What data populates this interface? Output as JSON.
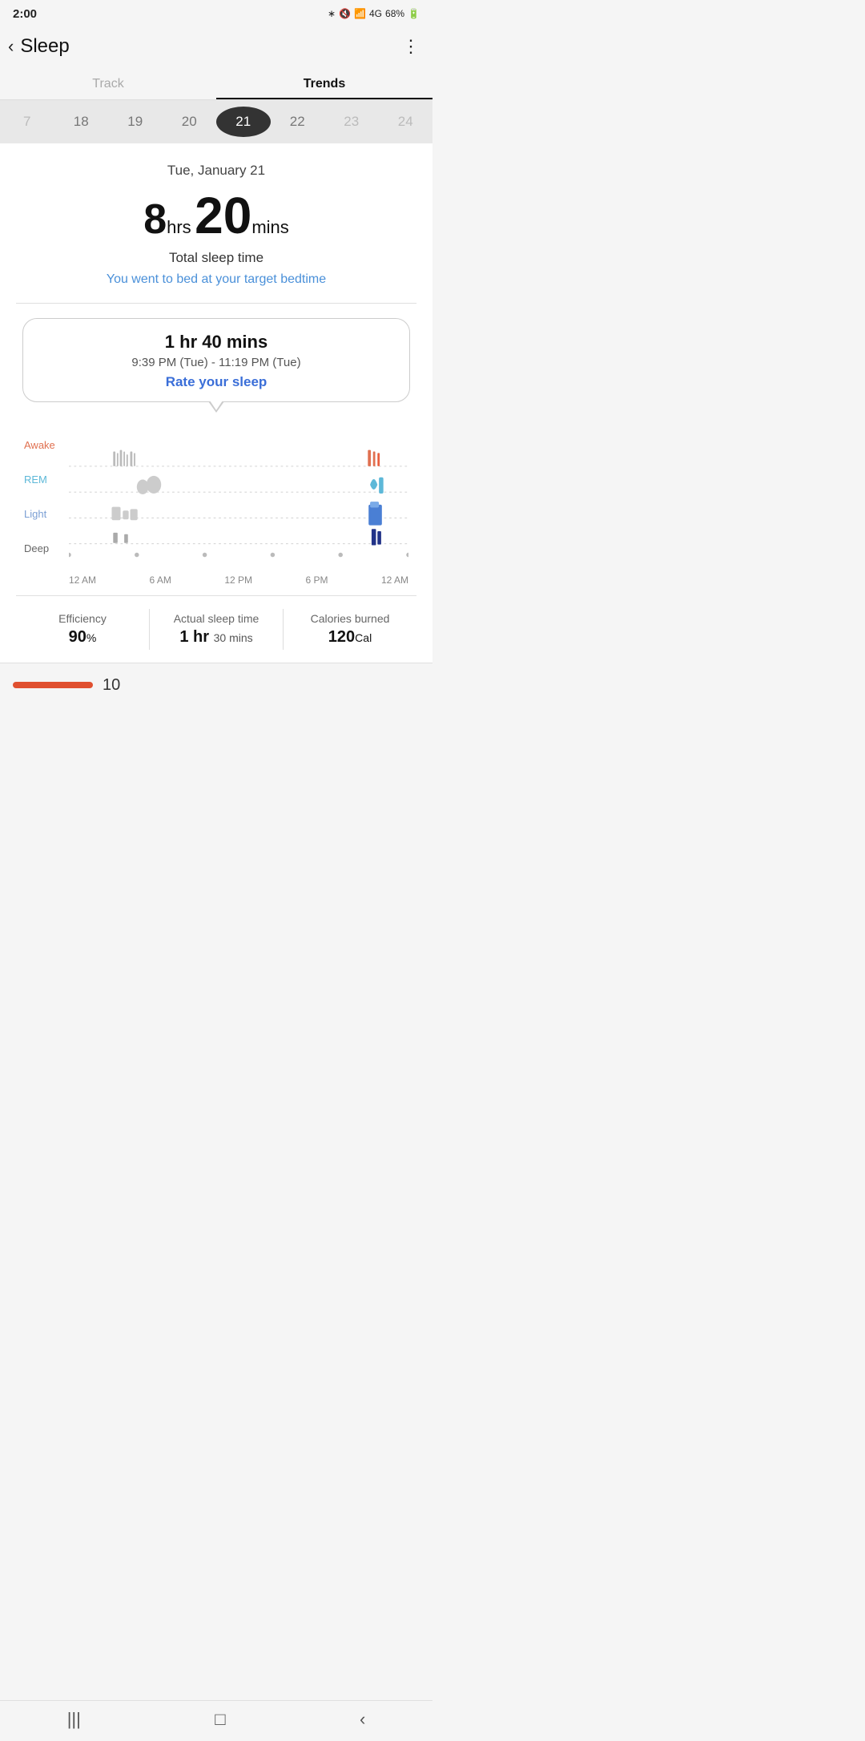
{
  "statusBar": {
    "time": "2:00",
    "battery": "68%"
  },
  "header": {
    "back": "‹",
    "title": "Sleep",
    "more": "⋮"
  },
  "tabs": [
    {
      "id": "track",
      "label": "Track"
    },
    {
      "id": "trends",
      "label": "Trends"
    }
  ],
  "activeTab": "trends",
  "dateScroll": {
    "items": [
      {
        "value": "7",
        "state": "normal"
      },
      {
        "value": "18",
        "state": "normal"
      },
      {
        "value": "19",
        "state": "normal"
      },
      {
        "value": "20",
        "state": "normal"
      },
      {
        "value": "21",
        "state": "active"
      },
      {
        "value": "22",
        "state": "normal"
      },
      {
        "value": "23",
        "state": "faded"
      },
      {
        "value": "24",
        "state": "faded"
      }
    ]
  },
  "sleepSummary": {
    "date": "Tue, January 21",
    "hours": "8",
    "hrsLabel": "hrs",
    "mins": "20",
    "minsLabel": "mins",
    "totalLabel": "Total sleep time",
    "message": "You went to bed at your target bedtime"
  },
  "sessionCard": {
    "duration": "1 hr 40 mins",
    "timeRange": "9:39 PM (Tue) - 11:19 PM (Tue)",
    "rateLabel": "Rate your sleep"
  },
  "chart": {
    "yLabels": [
      {
        "label": "Awake",
        "class": "awake"
      },
      {
        "label": "REM",
        "class": "rem"
      },
      {
        "label": "Light",
        "class": "light"
      },
      {
        "label": "Deep",
        "class": "deep"
      }
    ],
    "xLabels": [
      "12 AM",
      "6 AM",
      "12 PM",
      "6 PM",
      "12 AM"
    ]
  },
  "stats": [
    {
      "label": "Efficiency",
      "value": "90",
      "unit": "%",
      "sub": ""
    },
    {
      "label": "Actual sleep time",
      "mainValue": "1 hr",
      "subValue": "30 mins",
      "combined": true
    },
    {
      "label": "Calories burned",
      "value": "120",
      "unit": "Cal",
      "sub": ""
    }
  ],
  "bottomPreview": {
    "number": "10"
  },
  "navBar": {
    "icons": [
      "|||",
      "□",
      "‹"
    ]
  }
}
